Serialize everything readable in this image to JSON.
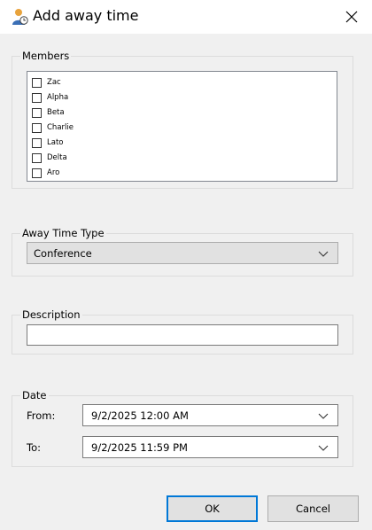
{
  "window": {
    "title": "Add away time",
    "app_icon": "user-clock-icon",
    "close_icon": "close-icon"
  },
  "members": {
    "legend": "Members",
    "items": [
      {
        "label": "Zac",
        "checked": false
      },
      {
        "label": "Alpha",
        "checked": false
      },
      {
        "label": "Beta",
        "checked": false
      },
      {
        "label": "Charlie",
        "checked": false
      },
      {
        "label": "Lato",
        "checked": false
      },
      {
        "label": "Delta",
        "checked": false
      },
      {
        "label": "Aro",
        "checked": false
      }
    ]
  },
  "away_type": {
    "legend": "Away Time Type",
    "selected": "Conference"
  },
  "description": {
    "legend": "Description",
    "value": ""
  },
  "date": {
    "legend": "Date",
    "from_label": "From:",
    "from_value": "9/2/2025 12:00 AM",
    "to_label": "To:",
    "to_value": "9/2/2025 11:59 PM"
  },
  "buttons": {
    "ok_label": "OK",
    "cancel_label": "Cancel"
  },
  "colors": {
    "default_button_border": "#0078d7",
    "window_background": "#f0f0f0"
  }
}
